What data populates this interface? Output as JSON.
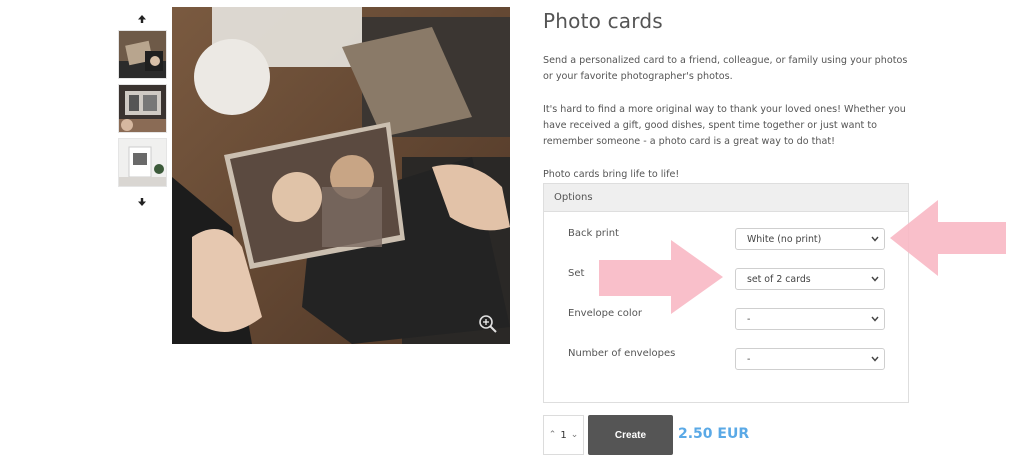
{
  "product": {
    "title": "Photo cards",
    "description_1": "Send a personalized card to a friend, colleague, or family using your photos or your favorite photographer's photos.",
    "description_2": "It's hard to find a more original way to thank your loved ones! Whether you have received a gift, good dishes, spent time together or just want to remember someone - a photo card is a great way to do that!",
    "tagline": "Photo cards bring life to life!"
  },
  "gallery": {
    "thumbnails": [
      "photo-thumbnail-1",
      "photo-thumbnail-2",
      "photo-thumbnail-3"
    ],
    "icons": {
      "up": "arrow-up-icon",
      "down": "arrow-down-icon",
      "zoom": "zoom-in-icon"
    }
  },
  "options": {
    "heading": "Options",
    "fields": [
      {
        "label": "Back print",
        "value": "White (no print)"
      },
      {
        "label": "Set",
        "value": "set of 2 cards"
      },
      {
        "label": "Envelope color",
        "value": "-"
      },
      {
        "label": "Number of envelopes",
        "value": "-"
      }
    ]
  },
  "purchase": {
    "quantity": "1",
    "create_label": "Create",
    "price": "2.50 EUR",
    "price_color": "#5aa9e6"
  },
  "annotations": {
    "arrow_color": "#f8b8c4"
  }
}
